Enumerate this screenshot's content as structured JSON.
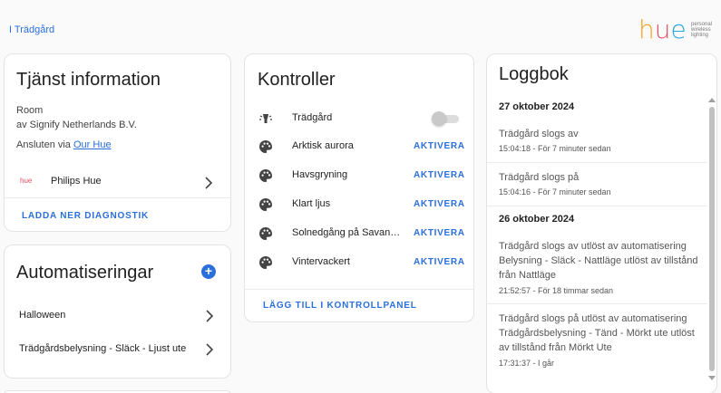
{
  "breadcrumb": "I Trädgård",
  "logo": {
    "letters": [
      "h",
      "u",
      "e"
    ],
    "letter_colors": [
      "#f6a21b",
      "#e94f64",
      "#27a6d9"
    ],
    "tagline": [
      "personal",
      "wireless",
      "lighting"
    ]
  },
  "service": {
    "title": "Tjänst information",
    "type": "Room",
    "vendor": "av Signify Netherlands B.V.",
    "connected_prefix": "Ansluten via",
    "connected_link": "Our Hue",
    "device_icon_text": "hue",
    "device_label": "Philips Hue",
    "download_label": "LADDA NER DIAGNOSTIK"
  },
  "automations": {
    "title": "Automatiseringar",
    "add_icon": "plus-circle-icon",
    "items": [
      {
        "label": "Halloween"
      },
      {
        "label": "Trädgårdsbelysning - Släck - Ljust ute"
      }
    ]
  },
  "controls": {
    "title": "Kontroller",
    "toggle_row": {
      "label": "Trädgård",
      "icon": "room-lights-icon",
      "state": "off"
    },
    "scenes": [
      {
        "label": "Arktisk aurora",
        "icon": "palette-icon",
        "button": "AKTIVERA"
      },
      {
        "label": "Havsgryning",
        "icon": "palette-icon",
        "button": "AKTIVERA"
      },
      {
        "label": "Klart ljus",
        "icon": "palette-icon",
        "button": "AKTIVERA"
      },
      {
        "label": "Solnedgång på Savannen",
        "icon": "palette-icon",
        "button": "AKTIVERA"
      },
      {
        "label": "Vintervackert",
        "icon": "palette-icon",
        "button": "AKTIVERA"
      }
    ],
    "add_to_dashboard": "LÄGG TILL I KONTROLLPANEL"
  },
  "log": {
    "title": "Loggbok",
    "groups": [
      {
        "date": "27 oktober 2024",
        "entries": [
          {
            "subject": "Trädgård",
            "text": "slogs av",
            "time": "15:04:18 - För 7 minuter sedan"
          },
          {
            "subject": "Trädgård",
            "text": "slogs på",
            "time": "15:04:16 - För 7 minuter sedan"
          }
        ]
      },
      {
        "date": "26 oktober 2024",
        "entries": [
          {
            "subject": "Trädgård",
            "text": "slogs av utlöst av automatisering",
            "detail": "Belysning - Släck - Nattläge utlöst av tillstånd från Nattläge",
            "time": "21:52:57 - För 18 timmar sedan"
          },
          {
            "subject": "Trädgård",
            "text": "slogs på utlöst av automatisering",
            "detail": "Trädgårdsbelysning - Tänd - Mörkt ute utlöst av tillstånd från Mörkt Ute",
            "time": "17:31:37 - I går"
          }
        ]
      }
    ]
  },
  "colors": {
    "accent": "#2a6fdb",
    "card_border": "#e3e3e3",
    "background": "#fafafa"
  }
}
